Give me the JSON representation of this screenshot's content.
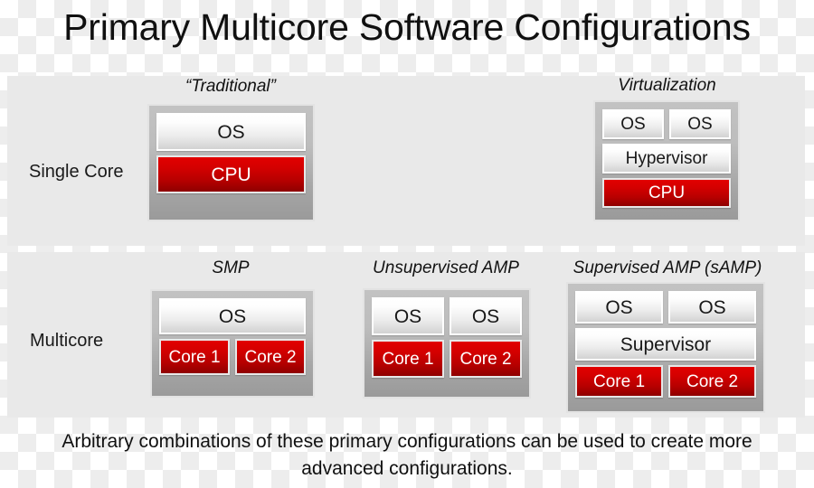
{
  "title": "Primary Multicore Software Configurations",
  "rows": [
    {
      "label": "Single Core",
      "blocks": [
        {
          "caption": "“Traditional”",
          "layers": [
            {
              "kind": "software",
              "cells": [
                "OS"
              ]
            },
            {
              "kind": "hardware",
              "cells": [
                "CPU"
              ]
            }
          ]
        },
        {
          "caption": "Virtualization",
          "layers": [
            {
              "kind": "software",
              "cells": [
                "OS",
                "OS"
              ]
            },
            {
              "kind": "software",
              "cells": [
                "Hypervisor"
              ]
            },
            {
              "kind": "hardware",
              "cells": [
                "CPU"
              ]
            }
          ]
        }
      ]
    },
    {
      "label": "Multicore",
      "blocks": [
        {
          "caption": "SMP",
          "layers": [
            {
              "kind": "software",
              "cells": [
                "OS"
              ]
            },
            {
              "kind": "hardware",
              "cells": [
                "Core 1",
                "Core 2"
              ]
            }
          ]
        },
        {
          "caption": "Unsupervised AMP",
          "layers": [
            {
              "kind": "software",
              "cells": [
                "OS",
                "OS"
              ]
            },
            {
              "kind": "hardware",
              "cells": [
                "Core 1",
                "Core 2"
              ]
            }
          ]
        },
        {
          "caption": "Supervised AMP (sAMP)",
          "layers": [
            {
              "kind": "software",
              "cells": [
                "OS",
                "OS"
              ]
            },
            {
              "kind": "software",
              "cells": [
                "Supervisor"
              ]
            },
            {
              "kind": "hardware",
              "cells": [
                "Core 1",
                "Core 2"
              ]
            }
          ]
        }
      ]
    }
  ],
  "footer": {
    "line1": "Arbitrary combinations of these primary configurations can be used to create more",
    "line2": "advanced configurations."
  },
  "colors": {
    "band_background": "#e9e9e9",
    "chip_gray_top": "#c2c2c2",
    "chip_gray_bottom": "#9a9a9a",
    "hardware_red_top": "#e20000",
    "hardware_red_bottom": "#8e0000",
    "software_white": "#ffffff",
    "text_dark": "#101010",
    "text_on_red": "#ffffff"
  }
}
